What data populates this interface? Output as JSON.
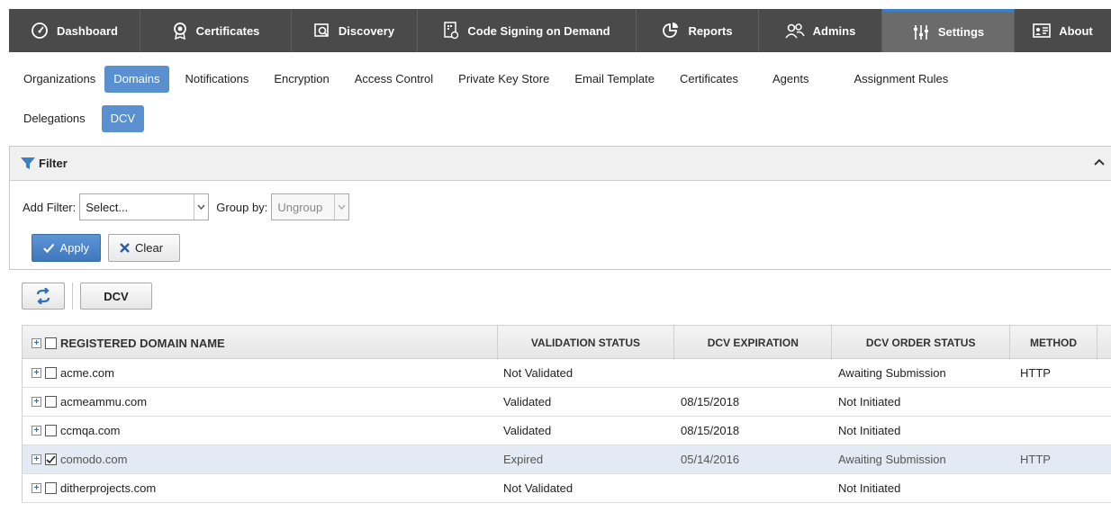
{
  "topnav": {
    "tabs": [
      {
        "label": "Dashboard",
        "icon": "dashboard-gauge-icon"
      },
      {
        "label": "Certificates",
        "icon": "certificate-badge-icon"
      },
      {
        "label": "Discovery",
        "icon": "discovery-scan-icon"
      },
      {
        "label": "Code Signing on Demand",
        "icon": "code-signing-icon"
      },
      {
        "label": "Reports",
        "icon": "reports-pie-icon"
      },
      {
        "label": "Admins",
        "icon": "admins-users-icon"
      },
      {
        "label": "Settings",
        "icon": "settings-sliders-icon",
        "active": true
      },
      {
        "label": "About",
        "icon": "about-card-icon"
      }
    ],
    "accent": "#3b7fc4"
  },
  "subnav": {
    "row1": [
      "Organizations",
      "Domains",
      "Notifications",
      "Encryption",
      "Access Control",
      "Private Key Store",
      "Email Template",
      "Certificates",
      "Agents",
      "Assignment Rules"
    ],
    "row2": [
      "Delegations",
      "DCV"
    ],
    "active_color": "#5a8fd0"
  },
  "filter": {
    "title": "Filter",
    "add_filter_label": "Add Filter:",
    "add_filter_value": "Select...",
    "group_by_label": "Group by:",
    "group_by_value": "Ungroup",
    "apply_label": "Apply",
    "clear_label": "Clear"
  },
  "toolbar": {
    "dcv_label": "DCV"
  },
  "table": {
    "columns": [
      "REGISTERED DOMAIN NAME",
      "VALIDATION STATUS",
      "DCV EXPIRATION",
      "DCV ORDER STATUS",
      "METHOD"
    ],
    "rows": [
      {
        "domain": "acme.com",
        "validation": "Not Validated",
        "expiration": "",
        "order_status": "Awaiting Submission",
        "method": "HTTP",
        "checked": false
      },
      {
        "domain": "acmeammu.com",
        "validation": "Validated",
        "expiration": "08/15/2018",
        "order_status": "Not Initiated",
        "method": "",
        "checked": false
      },
      {
        "domain": "ccmqa.com",
        "validation": "Validated",
        "expiration": "08/15/2018",
        "order_status": "Not Initiated",
        "method": "",
        "checked": false
      },
      {
        "domain": "comodo.com",
        "validation": "Expired",
        "expiration": "05/14/2016",
        "order_status": "Awaiting Submission",
        "method": "HTTP",
        "checked": true
      },
      {
        "domain": "ditherprojects.com",
        "validation": "Not Validated",
        "expiration": "",
        "order_status": "Not Initiated",
        "method": "",
        "checked": false
      }
    ]
  }
}
